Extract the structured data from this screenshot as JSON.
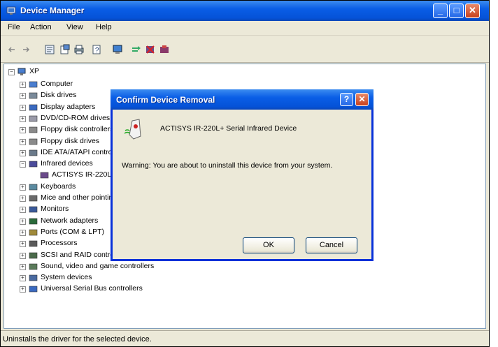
{
  "window": {
    "title": "Device Manager",
    "buttons": {
      "minimize": "_",
      "maximize": "□",
      "close": "✕"
    }
  },
  "menu": [
    "File",
    "Action",
    "View",
    "Help"
  ],
  "toolbar_icons": [
    "back-icon",
    "forward-icon",
    "properties-icon",
    "update-driver-icon",
    "print-icon",
    "help-icon",
    "scan-hardware-icon",
    "uninstall-icon",
    "disable-icon",
    "remove-icon"
  ],
  "tree": {
    "root": "XP",
    "items": [
      {
        "label": "Computer",
        "expander": "+"
      },
      {
        "label": "Disk drives",
        "expander": "+"
      },
      {
        "label": "Display adapters",
        "expander": "+"
      },
      {
        "label": "DVD/CD-ROM drives",
        "expander": "+"
      },
      {
        "label": "Floppy disk controllers",
        "expander": "+"
      },
      {
        "label": "Floppy disk drives",
        "expander": "+"
      },
      {
        "label": "IDE ATA/ATAPI controllers",
        "expander": "+"
      },
      {
        "label": "Infrared devices",
        "expander": "−"
      },
      {
        "label": "ACTISYS IR-220L+ Serial Infrared Device",
        "expander": "",
        "child": true
      },
      {
        "label": "Keyboards",
        "expander": "+"
      },
      {
        "label": "Mice and other pointing devices",
        "expander": "+"
      },
      {
        "label": "Monitors",
        "expander": "+"
      },
      {
        "label": "Network adapters",
        "expander": "+"
      },
      {
        "label": "Ports (COM & LPT)",
        "expander": "+"
      },
      {
        "label": "Processors",
        "expander": "+"
      },
      {
        "label": "SCSI and RAID controllers",
        "expander": "+"
      },
      {
        "label": "Sound, video and game controllers",
        "expander": "+"
      },
      {
        "label": "System devices",
        "expander": "+"
      },
      {
        "label": "Universal Serial Bus controllers",
        "expander": "+"
      }
    ]
  },
  "status": "Uninstalls the driver for the selected device.",
  "dialog": {
    "title": "Confirm Device Removal",
    "help": "?",
    "close": "✕",
    "device_name": "ACTISYS IR-220L+ Serial Infrared Device",
    "warning": "Warning: You are about to uninstall this device from your system.",
    "ok": "OK",
    "cancel": "Cancel"
  }
}
